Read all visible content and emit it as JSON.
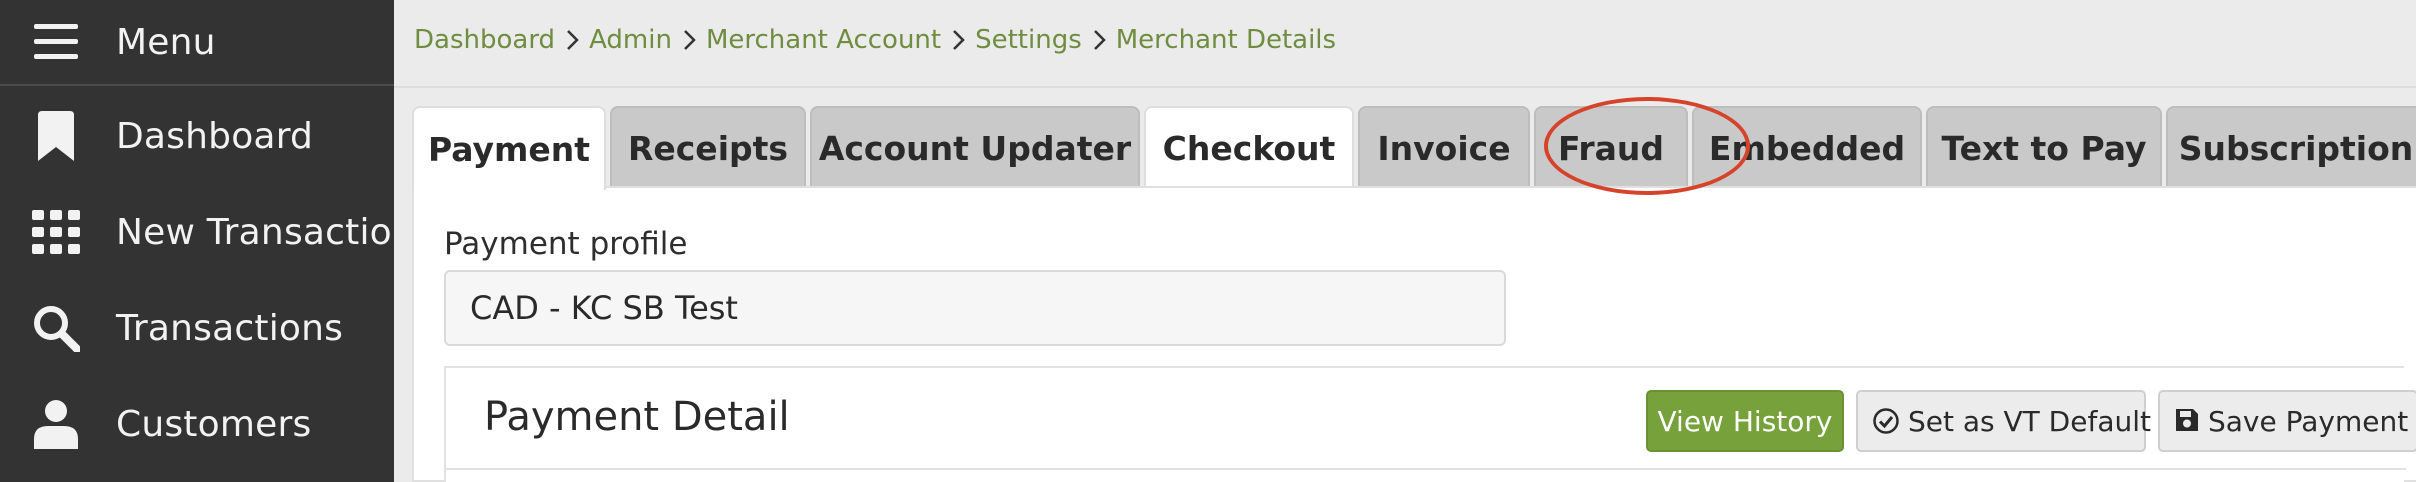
{
  "sidebar": {
    "menu_label": "Menu",
    "items": [
      {
        "label": "Dashboard",
        "icon": "bookmark-icon"
      },
      {
        "label": "New Transaction",
        "icon": "grid-icon"
      },
      {
        "label": "Transactions",
        "icon": "search-icon"
      },
      {
        "label": "Customers",
        "icon": "user-icon"
      }
    ]
  },
  "breadcrumb": [
    "Dashboard",
    "Admin",
    "Merchant Account",
    "Settings",
    "Merchant Details"
  ],
  "tabs": [
    {
      "label": "Payment",
      "active": true
    },
    {
      "label": "Receipts"
    },
    {
      "label": "Account Updater"
    },
    {
      "label": "Checkout",
      "highlighted": true
    },
    {
      "label": "Invoice"
    },
    {
      "label": "Fraud"
    },
    {
      "label": "Embedded"
    },
    {
      "label": "Text to Pay"
    },
    {
      "label": "Subscription"
    }
  ],
  "profile": {
    "label": "Payment profile",
    "value": "CAD - KC SB Test"
  },
  "detail": {
    "title": "Payment Detail",
    "buttons": {
      "history": "View History",
      "vt_default": "Set as VT Default",
      "save": "Save Payment P"
    }
  },
  "colors": {
    "accent_green": "#76a13b",
    "breadcrumb_link": "#6f8d3f",
    "highlight_oval": "#d5442a",
    "sidebar_bg": "#333333"
  }
}
